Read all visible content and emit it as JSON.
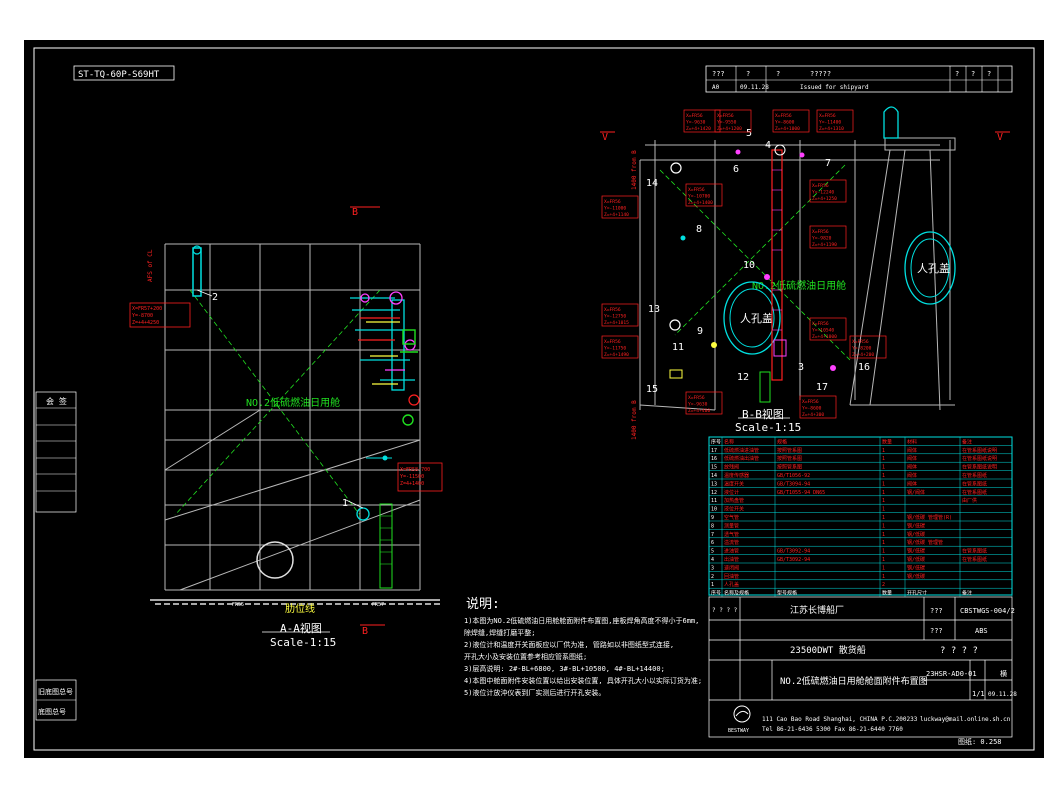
{
  "drawing": {
    "top_left_code": "ST-TQ-60P-S69HT",
    "title_strip": [
      "???",
      "?",
      "?",
      "?????",
      "?",
      "?",
      "?"
    ],
    "revision_row": {
      "mark": "A0",
      "date": "09.11.28",
      "text": "Issued for shipyard"
    },
    "left_box_label": "会 签",
    "bottom_left_labels": [
      "旧底图总号",
      "底图总号"
    ],
    "scale_readout": "图纸: 0.258"
  },
  "view_aa": {
    "tank_label": "NO.2低硫燃油日用舱",
    "title": "A-A视图",
    "scale": "Scale-1:15",
    "marker_top": "B",
    "marker_bottom": "B",
    "baseline_label": "肋位线",
    "frame_left": "FR55",
    "frame_right": "FR57",
    "callouts": [
      {
        "num": "2",
        "coords": [
          "X=FR57+200",
          "Y=-8700",
          "Z=+4+4250"
        ]
      },
      {
        "num": "1",
        "coords": [
          "X=FR58-700",
          "Y=-11500",
          "Z=4+1400"
        ]
      }
    ],
    "dimension_top": "AFS of CL"
  },
  "view_bb": {
    "tank_label": "NO.2低硫燃油日用舱",
    "manhole_label": "人孔盖",
    "manhole_label_right": "人孔盖",
    "title": "B-B视图",
    "scale": "Scale-1:15",
    "marker_v": "V",
    "dimension_top": "1400 from B",
    "dimension_bottom": "1400 from B",
    "numbers": [
      "5",
      "4",
      "7",
      "6",
      "14",
      "8",
      "10",
      "13",
      "9",
      "11",
      "3",
      "12",
      "16",
      "17",
      "15"
    ],
    "callouts": [
      [
        "X=FR56",
        "Y=-9630",
        "Z=+4+1420"
      ],
      [
        "X=FR56",
        "Y=-11000",
        "Z=+4+1140"
      ],
      [
        "X=FR56",
        "Y=-12750",
        "Z=+4+1015"
      ],
      [
        "X=FR56",
        "Y=-11750",
        "Z=+4+1490"
      ],
      [
        "X=FR56",
        "Y=-10700",
        "Z=+4+1400"
      ],
      [
        "X=FR56",
        "Y=-9550",
        "Z=+4+1200"
      ],
      [
        "X=FR56",
        "Y=-8600",
        "Z=+4+1000"
      ],
      [
        "X=FR56",
        "Y=-11400",
        "Z=+4+1310"
      ],
      [
        "X=FR56",
        "Y=-12240",
        "Z=+4+1250"
      ],
      [
        "X=FR56",
        "Y=-9820",
        "Z=+4+1190"
      ],
      [
        "X=FR56",
        "Y=-10540",
        "Z=+4+1000"
      ],
      [
        "X=FR56",
        "Y=-8200",
        "Z=+4+200"
      ],
      [
        "X=FR56",
        "Y=-9630",
        "Z=+4+400"
      ],
      [
        "X=FR56",
        "Y=-8600",
        "Z=+4+300"
      ]
    ]
  },
  "notes": {
    "heading": "说明:",
    "lines": [
      "1)本图为NO.2低硫燃油日用舱舱面附件布置图,座板焊角高度不得小于6mm,",
      "   除焊缝,焊缝打磨平整;",
      "2)液位计和温度开关面板应以厂供为准, 管路如以非图纸型式连接,",
      "   开孔大小及安装位置参考相应管系图纸;",
      "3)层高说明: 2#-BL+6800, 3#-BL+10500, 4#-BL+14400;",
      "4)本图中舱面附件安装位置以给出安装位置, 具体开孔大小以实际订货为准;",
      "5)液位计放沖仪表到厂实测后进行开孔安装。"
    ]
  },
  "parts_table": {
    "header_row": [
      "序号",
      "名称",
      "规格",
      "数量",
      "材料",
      "备注"
    ],
    "rows": [
      [
        "17",
        "低硫燃油进油管",
        "按照管系图",
        "1",
        "阀体",
        "在管系图纸说明"
      ],
      [
        "16",
        "低硫燃油出油管",
        "按照管系图",
        "1",
        "阀体",
        "在管系图纸说明"
      ],
      [
        "15",
        "放残阀",
        "按照管系图",
        "1",
        "阀体",
        "在管系图纸说明"
      ],
      [
        "14",
        "温度传感器",
        "GB/T1056-92",
        "1",
        "阀体",
        "在管系图纸"
      ],
      [
        "13",
        "温度开关",
        "GB/T3094-94",
        "1",
        "阀体",
        "在管系图纸"
      ],
      [
        "12",
        "液位计",
        "GB/T1055-94 DN65",
        "1",
        "钢/阀体",
        "在管系图纸"
      ],
      [
        "11",
        "加热盘管",
        "",
        "1",
        "",
        "由厂供"
      ],
      [
        "10",
        "液位开关",
        "",
        "1",
        "",
        ""
      ],
      [
        "9",
        "空气管",
        "",
        "1",
        "钢/低碳 管理管(R)",
        ""
      ],
      [
        "8",
        "测量管",
        "",
        "1",
        "钢/低碳",
        ""
      ],
      [
        "7",
        "透气管",
        "",
        "1",
        "钢/低碳",
        ""
      ],
      [
        "6",
        "溢流管",
        "",
        "1",
        "钢/低碳 管理管",
        ""
      ],
      [
        "5",
        "进油管",
        "GB/T3092-94",
        "1",
        "钢/低碳",
        "在管系图纸"
      ],
      [
        "4",
        "出油管",
        "GB/T3092-94",
        "1",
        "钢/低碳",
        "在管系图纸"
      ],
      [
        "3",
        "速闭阀",
        "",
        "1",
        "钢/低碳",
        ""
      ],
      [
        "2",
        "回油管",
        "",
        "1",
        "钢/低碳",
        ""
      ],
      [
        "1",
        "人孔盖",
        "",
        "2",
        "",
        ""
      ]
    ],
    "footer": [
      "序号",
      "名称及规格",
      "型号规格",
      "数量",
      "开孔尺寸",
      "备注"
    ]
  },
  "title_block": {
    "ship_company": "江苏长博船厂",
    "code_a": "???",
    "drawing_no": "CBSTWGS-004/2",
    "code_b": "???",
    "class": "ABS",
    "ship_type": "23500DWT 散货船",
    "question_marks": "? ? ? ?",
    "drawing_title": "NO.2低硫燃油日用舱舱面附件布置图",
    "serial": "23HSR-AD0-01",
    "sheet_label": "横",
    "sheet": "1/1",
    "date": "09.11.28",
    "company_logo": "BESTWAY",
    "address_line": "111 Cao Bao Road Shanghai, CHINA    P.C.200233",
    "phone_line": "Tel 86-21-6436 5300   Fax 86-21-6440 7760",
    "email_line": "luckway@mail.online.sh.cn"
  },
  "colors": {
    "background": "#000000",
    "frame": "#ffffff",
    "structure": "#c8c8c8",
    "red": "#ff2020",
    "cyan": "#00e0e0",
    "green": "#20e020",
    "magenta": "#ff40ff",
    "yellow": "#ffff40"
  }
}
